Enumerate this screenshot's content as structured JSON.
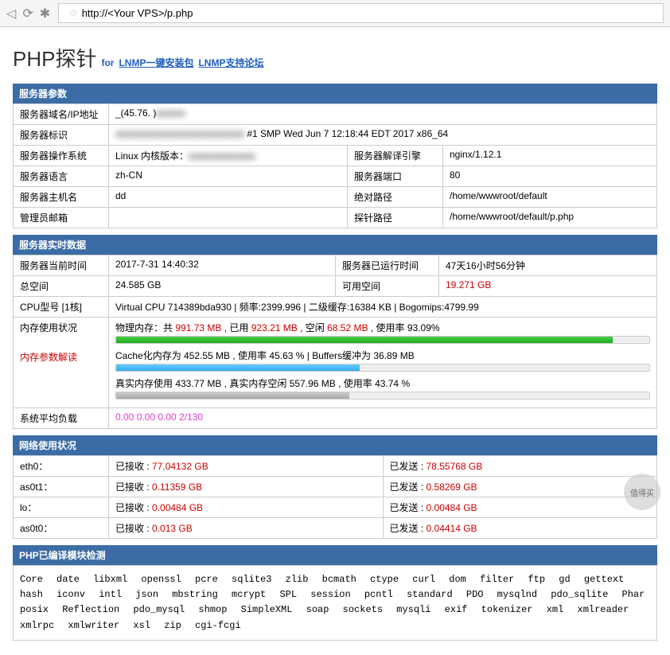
{
  "browser": {
    "url": "http://<Your VPS>/p.php"
  },
  "header": {
    "title": "PHP探针",
    "for": "for",
    "link1": "LNMP一键安装包",
    "link2": "LNMP支持论坛"
  },
  "section1": {
    "title": "服务器参数",
    "rows": {
      "domain_label": "服务器域名/IP地址",
      "domain_value": "_(45.76.     )",
      "id_label": "服务器标识",
      "id_value_hidden": "████████████████",
      "id_value_suffix": " #1 SMP Wed Jun 7 12:18:44 EDT 2017 x86_64",
      "os_label": "服务器操作系统",
      "os_value_prefix": "Linux  内核版本：",
      "os_value_hidden": "████████",
      "engine_label": "服务器解译引擎",
      "engine_value": "nginx/1.12.1",
      "lang_label": "服务器语言",
      "lang_value": "zh-CN",
      "port_label": "服务器端口",
      "port_value": "80",
      "host_label": "服务器主机名",
      "host_value": "dd",
      "abspath_label": "绝对路径",
      "abspath_value": "/home/wwwroot/default",
      "admin_label": "管理员邮箱",
      "admin_value": "",
      "probe_label": "探针路径",
      "probe_value": "/home/wwwroot/default/p.php"
    }
  },
  "section2": {
    "title": "服务器实时数据",
    "time_label": "服务器当前时间",
    "time_value": "2017-7-31 14:40:32",
    "uptime_label": "服务器已运行时间",
    "uptime_value": "47天16小时56分钟",
    "total_label": "总空间",
    "total_value": "24.585 GB",
    "avail_label": "可用空间",
    "avail_value": "19.271 GB",
    "cpu_label": "CPU型号 [1核]",
    "cpu_value": "Virtual CPU 714389bda930 | 频率:2399.996 | 二级缓存:16384 KB | Bogomips:4799.99",
    "mem_label": "内存使用状况",
    "mem_params_label": "内存参数解读",
    "mem_phys_prefix": "物理内存：共 ",
    "mem_phys_total": "991.73 MB",
    "mem_phys_used_prefix": " , 已用 ",
    "mem_phys_used": "923.21 MB",
    "mem_phys_free_prefix": " , 空闲 ",
    "mem_phys_free": "68.52 MB",
    "mem_phys_rate": " , 使用率 93.09%",
    "mem_cache": "Cache化内存为 452.55 MB , 使用率 45.63 % | Buffers缓冲为 36.89 MB",
    "mem_real": "真实内存使用 433.77 MB , 真实内存空闲 557.96 MB , 使用率 43.74 %",
    "load_label": "系统平均负载",
    "load_value": "0.00 0.00 0.00 2/130"
  },
  "section3": {
    "title": "网络使用状况",
    "rows": [
      {
        "iface": "eth0：",
        "rx_label": "已接收 : ",
        "rx": "77.04132 GB",
        "tx_label": "已发送 : ",
        "tx": "78.55768 GB"
      },
      {
        "iface": "as0t1：",
        "rx_label": "已接收 : ",
        "rx": "0.11359 GB",
        "tx_label": "已发送 : ",
        "tx": "0.58269 GB"
      },
      {
        "iface": "lo：",
        "rx_label": "已接收 : ",
        "rx": "0.00484 GB",
        "tx_label": "已发送 : ",
        "tx": "0.00484 GB"
      },
      {
        "iface": "as0t0：",
        "rx_label": "已接收 : ",
        "rx": "0.013 GB",
        "tx_label": "已发送 : ",
        "tx": "0.04414 GB"
      }
    ]
  },
  "section4": {
    "title": "PHP已编译模块检测",
    "modules": "Core date libxml openssl pcre sqlite3 zlib bcmath ctype curl dom filter ftp gd gettext hash iconv intl json mbstring mcrypt SPL session pcntl standard PDO mysqlnd pdo_sqlite Phar posix Reflection pdo_mysql shmop SimpleXML soap sockets mysqli exif tokenizer xml xmlreader xmlrpc xmlwriter xsl zip cgi-fcgi"
  },
  "watermark": "值得买"
}
